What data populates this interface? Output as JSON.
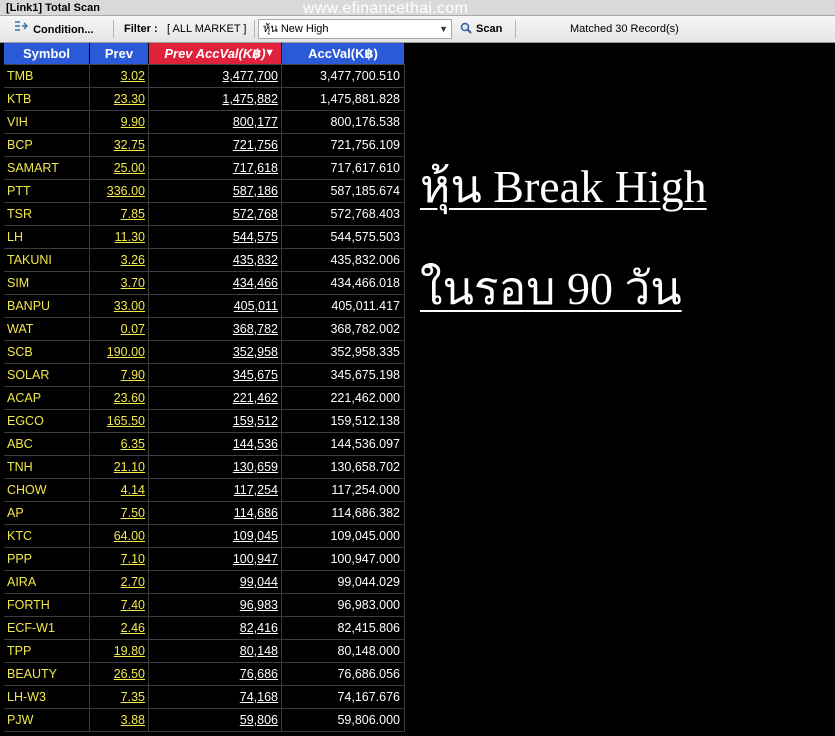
{
  "window": {
    "title": "[Link1] Total Scan"
  },
  "watermark": "www.efinancethai.com",
  "toolbar": {
    "condition_label": "Condition...",
    "filter_label": "Filter :",
    "filter_value": "[ ALL MARKET ]",
    "scan_type_selected": "หุ้น New High",
    "scan_label": "Scan",
    "matched_text": "Matched 30 Record(s)"
  },
  "icons": {
    "condition": "condition-icon",
    "scan": "magnifier-icon",
    "dropdown": "chevron-down-icon",
    "sort": "sort-desc-icon"
  },
  "colors": {
    "header_blue": "#2a5ad8",
    "header_sorted_red": "#e0213b",
    "symbol_yellow": "#f2e84a",
    "value_white": "#ffffff",
    "background": "#000000"
  },
  "table": {
    "columns": [
      "Symbol",
      "Prev",
      "Prev AccVal(K฿)",
      "AccVal(K฿)"
    ],
    "sorted_column": "Prev AccVal(K฿)",
    "rows": [
      [
        "TMB",
        "3.02",
        "3,477,700",
        "3,477,700.510"
      ],
      [
        "KTB",
        "23.30",
        "1,475,882",
        "1,475,881.828"
      ],
      [
        "VIH",
        "9.90",
        "800,177",
        "800,176.538"
      ],
      [
        "BCP",
        "32.75",
        "721,756",
        "721,756.109"
      ],
      [
        "SAMART",
        "25.00",
        "717,618",
        "717,617.610"
      ],
      [
        "PTT",
        "336.00",
        "587,186",
        "587,185.674"
      ],
      [
        "TSR",
        "7.85",
        "572,768",
        "572,768.403"
      ],
      [
        "LH",
        "11.30",
        "544,575",
        "544,575.503"
      ],
      [
        "TAKUNI",
        "3.26",
        "435,832",
        "435,832.006"
      ],
      [
        "SIM",
        "3.70",
        "434,466",
        "434,466.018"
      ],
      [
        "BANPU",
        "33.00",
        "405,011",
        "405,011.417"
      ],
      [
        "WAT",
        "0.07",
        "368,782",
        "368,782.002"
      ],
      [
        "SCB",
        "190.00",
        "352,958",
        "352,958.335"
      ],
      [
        "SOLAR",
        "7.90",
        "345,675",
        "345,675.198"
      ],
      [
        "ACAP",
        "23.60",
        "221,462",
        "221,462.000"
      ],
      [
        "EGCO",
        "165.50",
        "159,512",
        "159,512.138"
      ],
      [
        "ABC",
        "6.35",
        "144,536",
        "144,536.097"
      ],
      [
        "TNH",
        "21.10",
        "130,659",
        "130,658.702"
      ],
      [
        "CHOW",
        "4.14",
        "117,254",
        "117,254.000"
      ],
      [
        "AP",
        "7.50",
        "114,686",
        "114,686.382"
      ],
      [
        "KTC",
        "64.00",
        "109,045",
        "109,045.000"
      ],
      [
        "PPP",
        "7.10",
        "100,947",
        "100,947.000"
      ],
      [
        "AIRA",
        "2.70",
        "99,044",
        "99,044.029"
      ],
      [
        "FORTH",
        "7.40",
        "96,983",
        "96,983.000"
      ],
      [
        "ECF-W1",
        "2.46",
        "82,416",
        "82,415.806"
      ],
      [
        "TPP",
        "19.80",
        "80,148",
        "80,148.000"
      ],
      [
        "BEAUTY",
        "26.50",
        "76,686",
        "76,686.056"
      ],
      [
        "LH-W3",
        "7.35",
        "74,168",
        "74,167.676"
      ],
      [
        "PJW",
        "3.88",
        "59,806",
        "59,806.000"
      ]
    ]
  },
  "overlay": {
    "line1": "หุ้น Break High",
    "line2": "ในรอบ 90 วัน"
  }
}
